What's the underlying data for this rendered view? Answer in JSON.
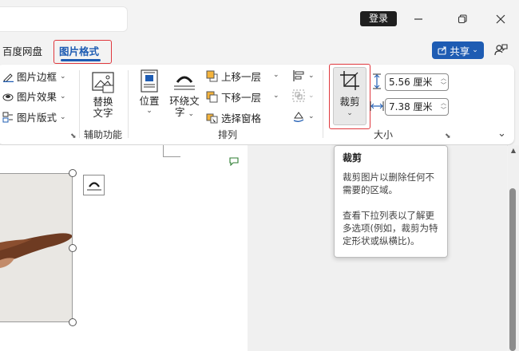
{
  "titlebar": {
    "login_label": "登录"
  },
  "tabs": [
    {
      "label": "百度网盘",
      "active": false
    },
    {
      "label": "图片格式",
      "active": true
    }
  ],
  "share_label": "共享",
  "ribbon": {
    "picture_styles": [
      {
        "label": "图片边框",
        "icon": "border-icon"
      },
      {
        "label": "图片效果",
        "icon": "effects-icon"
      },
      {
        "label": "图片版式",
        "icon": "layout-icon"
      }
    ],
    "alt_text": {
      "line1": "替换",
      "line2": "文字"
    },
    "position_label": "位置",
    "wrap_text": {
      "line1": "环绕文",
      "line2": "字"
    },
    "arrange_items": [
      {
        "label": "上移一层"
      },
      {
        "label": "下移一层"
      },
      {
        "label": "选择窗格"
      }
    ],
    "crop_label": "裁剪",
    "height_value": "5.56 厘米",
    "width_value": "7.38 厘米",
    "groups": {
      "accessibility": "辅助功能",
      "arrange": "排列",
      "size": "大小"
    }
  },
  "tooltip": {
    "title": "裁剪",
    "line1": "裁剪图片以删除任何不需要的区域。",
    "line2": "查看下拉列表以了解更多选项(例如，裁剪为特定形状或纵横比)。"
  },
  "colors": {
    "accent": "#1e5cb3",
    "highlight_border": "#e0383e"
  }
}
